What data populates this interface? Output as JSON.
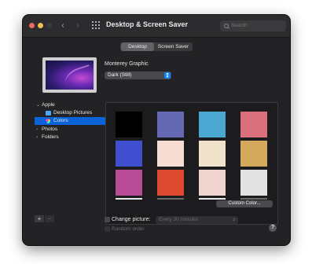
{
  "window": {
    "title": "Desktop & Screen Saver"
  },
  "toolbar": {
    "back_icon": "chevron-left-icon",
    "forward_icon": "chevron-right-icon",
    "grid_icon": "show-all-grid-icon"
  },
  "search": {
    "placeholder": "Search"
  },
  "tabs": [
    {
      "label": "Desktop",
      "selected": true
    },
    {
      "label": "Screen Saver",
      "selected": false
    }
  ],
  "preview": {
    "name": "Monterey Graphic",
    "appearance_value": "Dark (Still)"
  },
  "sidebar": {
    "apple_label": "Apple",
    "desktop_pictures_label": "Desktop Pictures",
    "colors_label": "Colors",
    "photos_label": "Photos",
    "folders_label": "Folders"
  },
  "list_buttons": {
    "add": "+",
    "remove": "−"
  },
  "swatches": [
    {
      "color": "#000000"
    },
    {
      "color": "#6569b3"
    },
    {
      "color": "#4aa8d3"
    },
    {
      "color": "#d9707c"
    },
    {
      "color": "#3f4fd0"
    },
    {
      "color": "#f6ddd2"
    },
    {
      "color": "#f1e3cb"
    },
    {
      "color": "#d4a95c"
    },
    {
      "color": "#b74b97"
    },
    {
      "color": "#dd4a2f"
    },
    {
      "color": "#efd4cf"
    },
    {
      "color": "#e2e2e2"
    }
  ],
  "custom_color_button": "Custom Color...",
  "change_picture": {
    "label": "Change picture:",
    "interval": "Every 30 minutes",
    "checked": false
  },
  "random_order": {
    "label": "Random order",
    "checked": false
  },
  "help": "?"
}
